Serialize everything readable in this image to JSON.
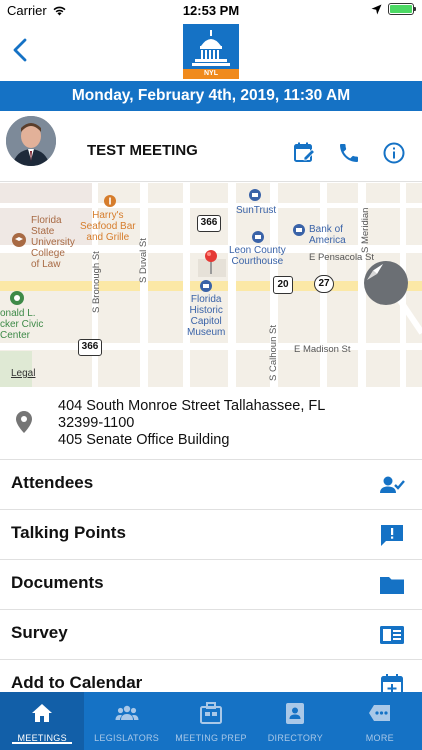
{
  "status_bar": {
    "carrier": "Carrier",
    "time": "12:53 PM",
    "battery_level": 1.0
  },
  "header": {
    "back_icon": "chevron-left-icon",
    "logo_text": "NYL"
  },
  "date_bar": {
    "text": "Monday, February 4th, 2019, 11:30 AM"
  },
  "meeting": {
    "title": "TEST MEETING",
    "actions": [
      "edit-calendar-icon",
      "phone-icon",
      "info-icon"
    ]
  },
  "map": {
    "labels": {
      "fsu_law": "Florida\nState\nUniversity\nCollege\nof Law",
      "harrys": "Harry's\nSeafood Bar\nand Grille",
      "suntrust": "SunTrust",
      "bank_of_america": "Bank of\nAmerica",
      "leon_county": "Leon County\nCourthouse",
      "capitol_museum": "Florida\nHistoric\nCapitol\nMuseum",
      "donald_l": "onald L.\ncker Civic\nCenter",
      "s_duval": "S Duval St",
      "s_bronough": "S Bronough St",
      "s_calhoun": "S Calhoun St",
      "s_meridian": "S Meridian",
      "e_pensacola": "E Pensacola St",
      "e_madison": "E Madison St",
      "shield_366_a": "366",
      "shield_366_b": "366",
      "shield_20": "20",
      "shield_27": "27",
      "shield_20_b": "20"
    },
    "legal": "Legal"
  },
  "address": {
    "line1": "404 South Monroe Street Tallahassee, FL",
    "line2": "32399-1100",
    "line3": "405 Senate Office Building"
  },
  "menu": [
    {
      "label": "Attendees",
      "icon": "attendees-icon"
    },
    {
      "label": "Talking Points",
      "icon": "talking-points-icon"
    },
    {
      "label": "Documents",
      "icon": "folder-icon"
    },
    {
      "label": "Survey",
      "icon": "survey-icon"
    },
    {
      "label": "Add to Calendar",
      "icon": "add-calendar-icon"
    }
  ],
  "tabs": [
    {
      "label": "MEETINGS",
      "icon": "home-icon",
      "active": true
    },
    {
      "label": "LEGISLATORS",
      "icon": "people-icon",
      "active": false
    },
    {
      "label": "MEETING PREP",
      "icon": "briefcase-icon",
      "active": false
    },
    {
      "label": "DIRECTORY",
      "icon": "contact-card-icon",
      "active": false
    },
    {
      "label": "MORE",
      "icon": "more-icon",
      "active": false
    }
  ],
  "colors": {
    "brand_blue": "#1572c5",
    "brand_orange": "#f08a1c"
  }
}
